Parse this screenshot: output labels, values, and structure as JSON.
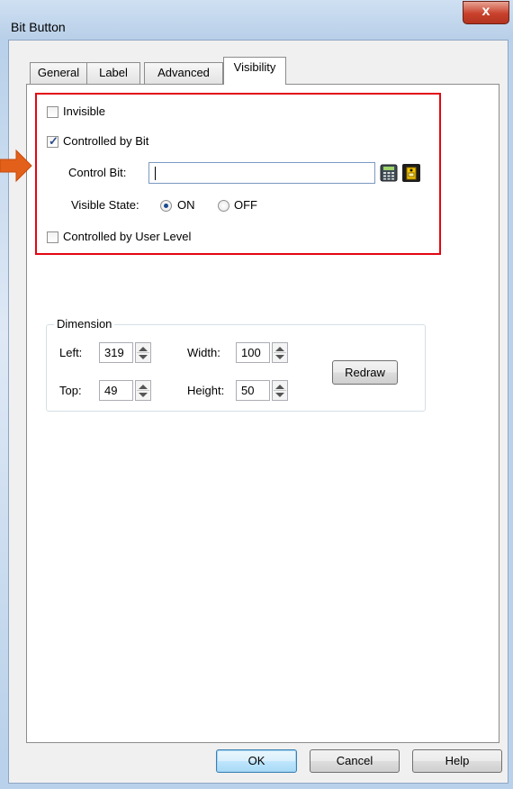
{
  "window": {
    "title": "Bit Button",
    "close_label": "x"
  },
  "tabs": [
    {
      "label": "General"
    },
    {
      "label": "Label"
    },
    {
      "label": "Advanced"
    },
    {
      "label": "Visibility"
    }
  ],
  "visibility": {
    "invisible": {
      "label": "Invisible",
      "checked": false
    },
    "controlled_by_bit": {
      "label": "Controlled by Bit",
      "checked": true
    },
    "control_bit": {
      "label": "Control Bit:",
      "value": ""
    },
    "visible_state": {
      "label": "Visible State:",
      "options": [
        "ON",
        "OFF"
      ],
      "selected": "ON"
    },
    "controlled_by_user_level": {
      "label": "Controlled by User Level",
      "checked": false
    }
  },
  "dimension": {
    "title": "Dimension",
    "left": {
      "label": "Left:",
      "value": "319"
    },
    "top": {
      "label": "Top:",
      "value": "49"
    },
    "width": {
      "label": "Width:",
      "value": "100"
    },
    "height": {
      "label": "Height:",
      "value": "50"
    },
    "redraw_label": "Redraw"
  },
  "buttons": {
    "ok": "OK",
    "cancel": "Cancel",
    "help": "Help"
  },
  "colors": {
    "highlight": "#e30613",
    "arrow": "#e2601a"
  },
  "icons": [
    "calculator-icon",
    "tag-icon",
    "close-icon",
    "spin-up-icon",
    "spin-down-icon"
  ]
}
